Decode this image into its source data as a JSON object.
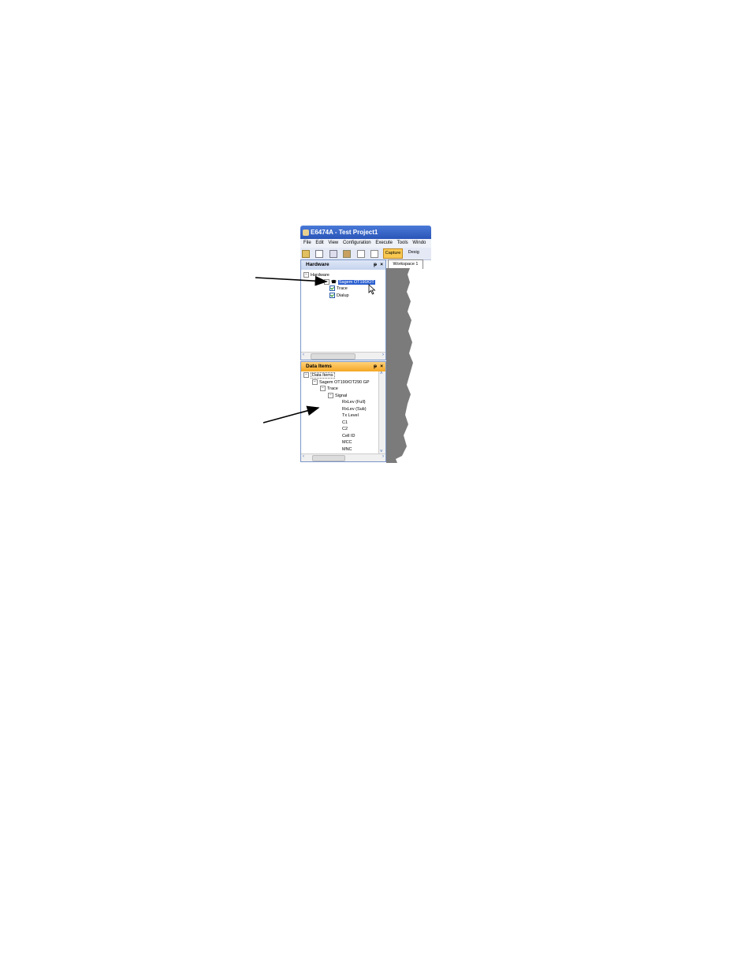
{
  "window": {
    "title": "E6474A - Test Project1"
  },
  "menu": [
    "File",
    "Edit",
    "View",
    "Configuration",
    "Execute",
    "Tools",
    "Windo"
  ],
  "toolbar": {
    "capture_label": "Capture",
    "design_label": "Desig"
  },
  "workspace_tab": "Workspace 1",
  "hardware_pane": {
    "title": "Hardware",
    "root": "Hardware",
    "device": "Sagem OT190/OT",
    "children": [
      "Trace",
      "Dialup"
    ]
  },
  "data_items_pane": {
    "title": "Data Items",
    "root": "Data Items",
    "device": "Sagem OT190/OT290 GP",
    "group": "Trace",
    "subgroup": "Signal",
    "items": [
      "RxLev (Full)",
      "RxLev (Sub)",
      "Tx Level",
      "C1",
      "C2",
      "Cell ID",
      "MCC",
      "MNC"
    ]
  }
}
